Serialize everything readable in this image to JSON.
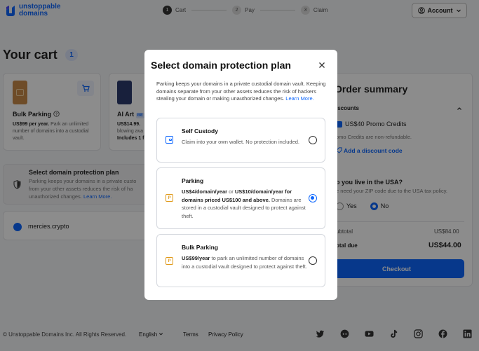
{
  "header": {
    "logo_line1": "unstoppable",
    "logo_line2": "domains",
    "steps": [
      {
        "num": "1",
        "label": "Cart"
      },
      {
        "num": "2",
        "label": "Pay"
      },
      {
        "num": "3",
        "label": "Claim"
      }
    ],
    "account_label": "Account"
  },
  "cart": {
    "title": "Your cart",
    "count": "1",
    "products": [
      {
        "name": "Bulk Parking",
        "price": "US$99 per year.",
        "desc": " Park an unlimited number of domains into a custodial vault."
      },
      {
        "name": "AI Art",
        "badge": "BE",
        "price": "US$14.99.",
        "desc": " blowing ava",
        "extra": "Includes 1 f"
      }
    ],
    "protection": {
      "title": "Select domain protection plan",
      "desc_part1": "Parking keeps your domains in a private custo",
      "desc_part2": "from your other assets reduces the risk of ha",
      "desc_part3": "unauthorized changes.",
      "learn_more": "Learn More."
    },
    "domain": "mercies.crypto"
  },
  "summary": {
    "title": "Order summary",
    "discounts_label": "iscounts",
    "promo_label": "US$40 Promo Credits",
    "promo_note": "omo Credits are non-refundable.",
    "discount_code": "Add a discount code",
    "usa_question": "o you live in the USA?",
    "usa_note": "e need your ZIP code due to the USA tax policy.",
    "yes": "Yes",
    "no": "No",
    "subtotal_label": "ubtotal",
    "subtotal_value": "US$84.00",
    "total_label": "otal due",
    "total_value": "US$44.00",
    "checkout": "Checkout"
  },
  "footer": {
    "copyright": "© Unstoppable Domains Inc. All Rights Reserved.",
    "language": "English",
    "terms": "Terms",
    "privacy": "Privacy Policy",
    "socials": [
      "twitter-icon",
      "discord-icon",
      "youtube-icon",
      "tiktok-icon",
      "instagram-icon",
      "facebook-icon",
      "linkedin-icon"
    ]
  },
  "modal": {
    "title": "Select domain protection plan",
    "desc": "Parking keeps your domains in a private custodial domain vault. Keeping domains separate from your other assets reduces the risk of hackers stealing your domain or making unauthorized changes.",
    "learn_more": "Learn More.",
    "options": [
      {
        "name": "Self Custody",
        "desc": "Claim into your own wallet. No protection included.",
        "selected": false
      },
      {
        "name": "Parking",
        "price1": "US$4/domain/year",
        "or": " or ",
        "price2": "US$10/domain/year for domains priced US$100 and above.",
        "desc": " Domains are stored in a custodial vault designed to protect against theft.",
        "selected": true
      },
      {
        "name": "Bulk Parking",
        "price": "US$99/year",
        "desc": " to park an unlimited number of domains into a custodial vault designed to protect against theft.",
        "selected": false
      }
    ]
  },
  "colors": {
    "accent": "#0d67fe",
    "overlay": "rgba(0,0,0,0.45)"
  }
}
